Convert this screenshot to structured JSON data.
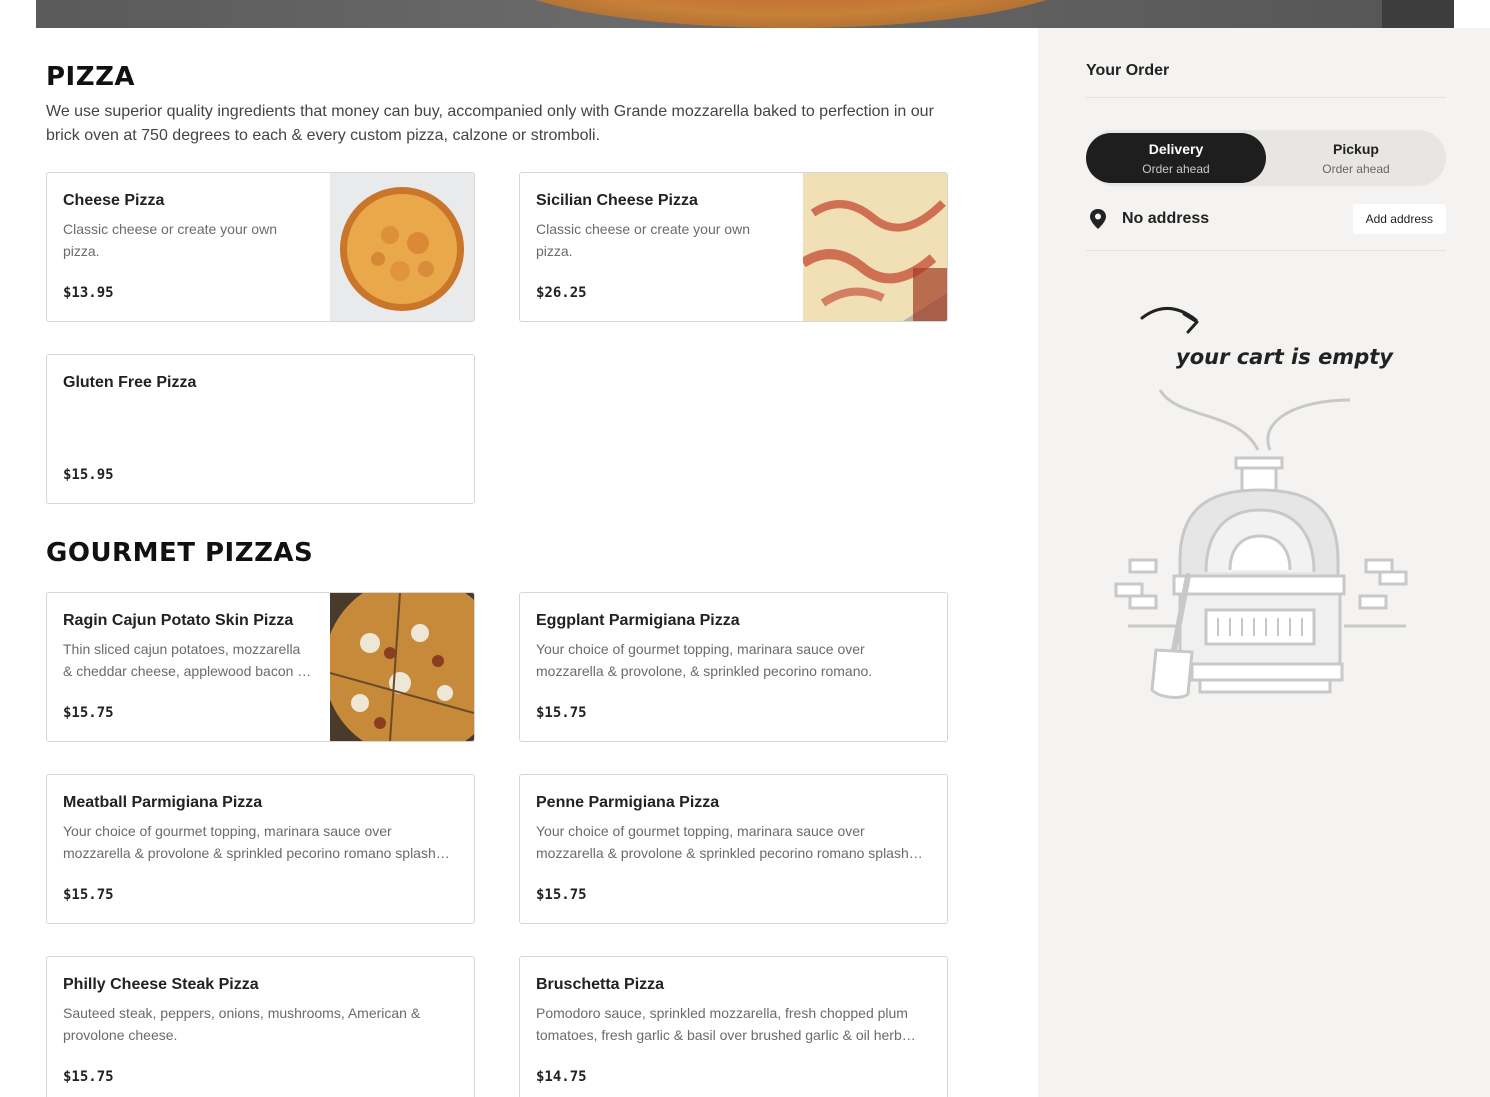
{
  "sections": [
    {
      "title": "PIZZA",
      "description": "We use superior quality ingredients that money can buy, accompanied only with Grande mozzarella baked to perfection in our brick oven at 750 degrees to each & every custom pizza, calzone or stromboli.",
      "items": [
        {
          "name": "Cheese Pizza",
          "desc": "Classic cheese or create your own pizza.",
          "price": "$13.95",
          "image": "cheese-pizza-photo"
        },
        {
          "name": "Sicilian Cheese Pizza",
          "desc": "Classic cheese or create your own pizza.",
          "price": "$26.25",
          "image": "sicilian-pizza-photo"
        },
        {
          "name": "Gluten Free Pizza",
          "desc": "",
          "price": "$15.95",
          "image": ""
        }
      ]
    },
    {
      "title": "GOURMET PIZZAS",
      "description": "",
      "items": [
        {
          "name": "Ragin Cajun Potato Skin Pizza",
          "desc": "Thin sliced cajun potatoes, mozzarella & cheddar cheese, applewood bacon …",
          "price": "$15.75",
          "image": "cajun-pizza-photo"
        },
        {
          "name": "Eggplant Parmigiana Pizza",
          "desc": "Your choice of gourmet topping, marinara sauce over mozzarella & provolone, & sprinkled pecorino romano.",
          "price": "$15.75",
          "image": ""
        },
        {
          "name": "Meatball Parmigiana Pizza",
          "desc": "Your choice of gourmet topping, marinara sauce over mozzarella & provolone & sprinkled pecorino romano splash…",
          "price": "$15.75",
          "image": ""
        },
        {
          "name": "Penne Parmigiana Pizza",
          "desc": "Your choice of gourmet topping, marinara sauce over mozzarella & provolone & sprinkled pecorino romano splash…",
          "price": "$15.75",
          "image": ""
        },
        {
          "name": "Philly Cheese Steak Pizza",
          "desc": "Sauteed steak, peppers, onions, mushrooms, American & provolone cheese.",
          "price": "$15.75",
          "image": ""
        },
        {
          "name": "Bruschetta Pizza",
          "desc": "Pomodoro sauce, sprinkled mozzarella, fresh chopped plum tomatoes, fresh garlic & basil over brushed garlic & oil herb…",
          "price": "$14.75",
          "image": ""
        }
      ]
    }
  ],
  "sidebar": {
    "title": "Your Order",
    "toggle": {
      "delivery": {
        "label": "Delivery",
        "sub": "Order ahead",
        "active": true
      },
      "pickup": {
        "label": "Pickup",
        "sub": "Order ahead",
        "active": false
      }
    },
    "address": {
      "label": "No address",
      "button": "Add address",
      "icon": "map-pin-icon"
    },
    "empty_cart": {
      "caption": "your cart is empty",
      "illustration": "pizza-oven-illustration"
    }
  },
  "colors": {
    "accent_dark": "#1e1e1e",
    "sidebar_bg": "#f4f3f1",
    "card_border": "#d6d6d6"
  }
}
